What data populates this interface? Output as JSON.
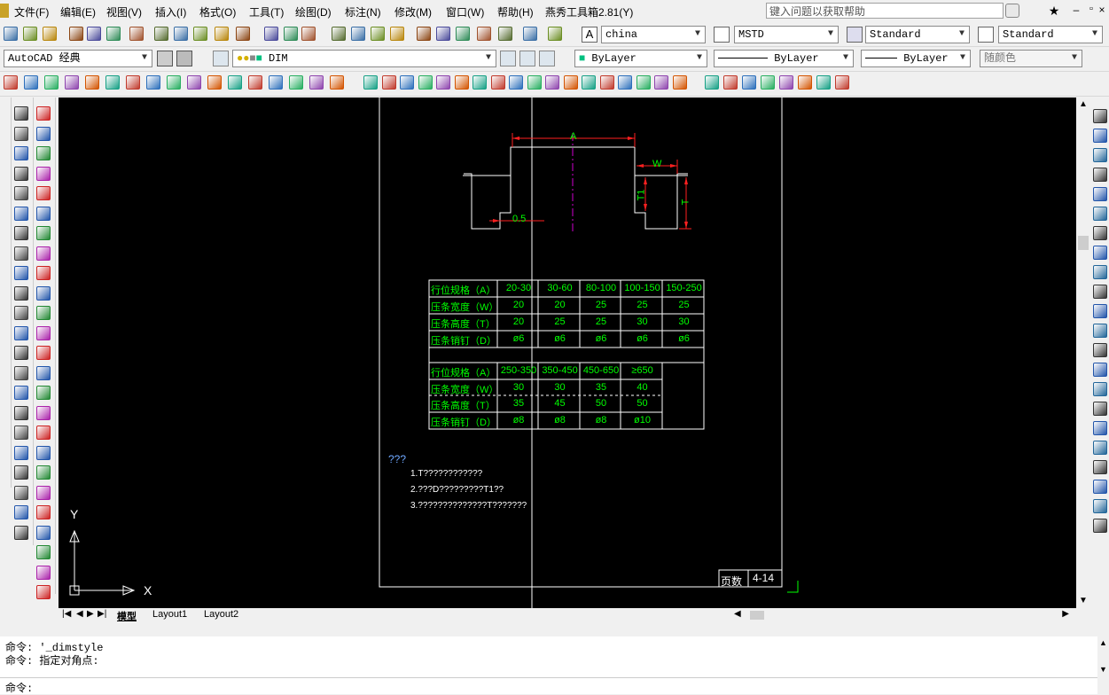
{
  "menu": {
    "items": [
      "文件(F)",
      "编辑(E)",
      "视图(V)",
      "插入(I)",
      "格式(O)",
      "工具(T)",
      "绘图(D)",
      "标注(N)",
      "修改(M)",
      "窗口(W)",
      "帮助(H)",
      "燕秀工具箱2.81(Y)"
    ],
    "help_placeholder": "键入问题以获取帮助"
  },
  "toolbar": {
    "text_style": "china",
    "dim_style": "MSTD",
    "table_style": "Standard",
    "multileader_style": "Standard",
    "workspace": "AutoCAD 经典",
    "layer": "DIM",
    "color": "ByLayer",
    "linetype": "ByLayer",
    "lineweight": "ByLayer",
    "plot_style": "随颜色"
  },
  "drawing": {
    "dims": {
      "a": "A",
      "w": "W",
      "t": "T",
      "t1": "T1",
      "chamfer": "0.5"
    },
    "table1": {
      "headers": [
        "行位规格（A）",
        "20-30",
        "30-60",
        "80-100",
        "100-150",
        "150-250"
      ],
      "rows": [
        [
          "压条宽度（W）",
          "20",
          "20",
          "25",
          "25",
          "25"
        ],
        [
          "压条高度（T）",
          "20",
          "25",
          "25",
          "30",
          "30"
        ],
        [
          "压条销钉（D）",
          "ø6",
          "ø6",
          "ø6",
          "ø6",
          "ø6"
        ]
      ]
    },
    "table2": {
      "headers": [
        "行位规格（A）",
        "250-350",
        "350-450",
        "450-650",
        "≥650"
      ],
      "rows": [
        [
          "压条宽度（W）",
          "30",
          "30",
          "35",
          "40"
        ],
        [
          "压条高度（T）",
          "35",
          "45",
          "50",
          "50"
        ],
        [
          "压条销钉（D）",
          "ø8",
          "ø8",
          "ø8",
          "ø10"
        ]
      ]
    },
    "notes_title": "???",
    "notes": [
      "1.T????????????",
      "2.???D?????????T1??",
      "3.??????????????T???????"
    ],
    "page_label": "页数",
    "page_value": "4-14",
    "ucs_x": "X",
    "ucs_y": "Y"
  },
  "tabs": [
    "模型",
    "Layout1",
    "Layout2"
  ],
  "command": {
    "history": [
      "命令: '_dimstyle",
      "命令: 指定对角点:"
    ],
    "prompt": "命令:"
  }
}
